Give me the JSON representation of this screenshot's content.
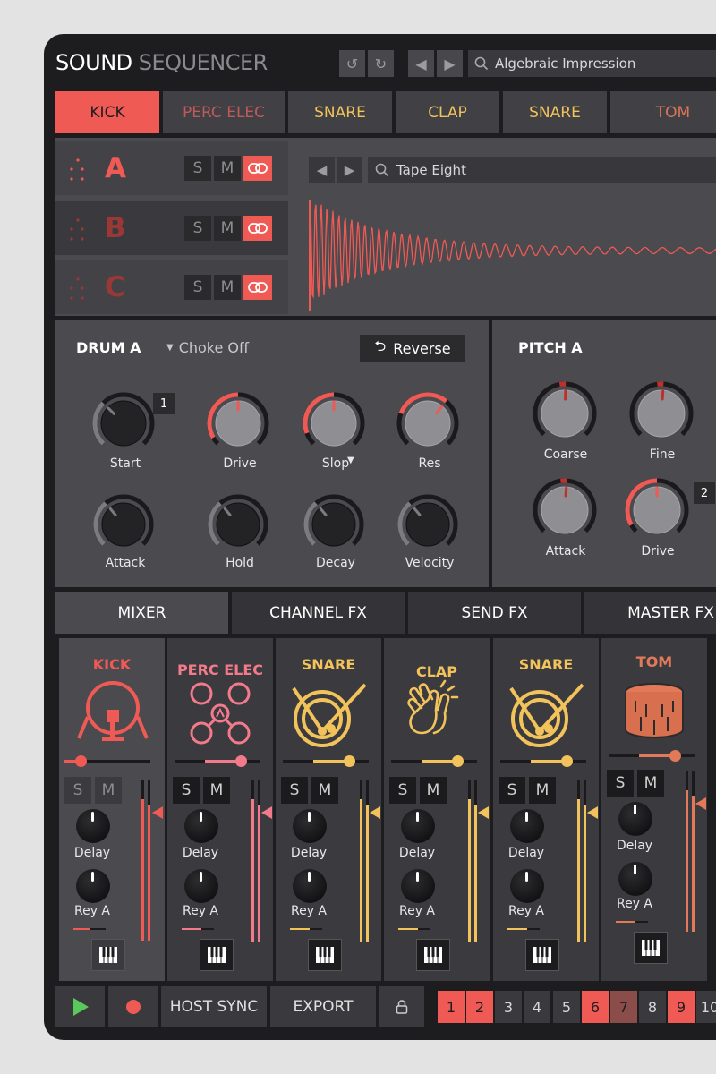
{
  "app": {
    "title_part1": "SOUND",
    "title_part2": "SEQUENCER"
  },
  "toolbar": {
    "search_value": "Algebraic Impression"
  },
  "tabs": [
    {
      "label": "KICK",
      "color": "#f05a55",
      "active": true
    },
    {
      "label": "PERC ELEC",
      "color": "#c05a5a"
    },
    {
      "label": "SNARE",
      "color": "#f2c35a"
    },
    {
      "label": "CLAP",
      "color": "#f2c35a"
    },
    {
      "label": "SNARE",
      "color": "#f2c35a"
    },
    {
      "label": "TOM",
      "color": "#d9765a"
    }
  ],
  "layers": [
    {
      "letter": "A",
      "color": "#f05a55",
      "s": "S",
      "m": "M"
    },
    {
      "letter": "B",
      "color": "#9a3835",
      "s": "S",
      "m": "M"
    },
    {
      "letter": "C",
      "color": "#9a3835",
      "s": "S",
      "m": "M"
    }
  ],
  "sample": {
    "search_value": "Tape Eight"
  },
  "drum": {
    "title": "DRUM A",
    "choke": "Choke Off",
    "reverse": "Reverse",
    "badge": "1",
    "knobs_row1": [
      "Start",
      "Drive",
      "Slop",
      "Res"
    ],
    "knobs_row2": [
      "Attack",
      "Hold",
      "Decay",
      "Velocity"
    ]
  },
  "pitch": {
    "title": "PITCH A",
    "badge": "2",
    "knobs": [
      "Coarse",
      "Fine",
      "Attack",
      "Drive"
    ]
  },
  "lower_tabs": [
    "MIXER",
    "CHANNEL FX",
    "SEND FX",
    "MASTER FX"
  ],
  "strips": [
    {
      "name": "KICK",
      "color": "#f05a55",
      "delay": "Delay",
      "rey": "Rey A",
      "s": "S",
      "m": "M"
    },
    {
      "name": "PERC ELEC",
      "color": "#f27a8a",
      "delay": "Delay",
      "rey": "Rey A",
      "s": "S",
      "m": "M"
    },
    {
      "name": "SNARE",
      "color": "#f2c35a",
      "delay": "Delay",
      "rey": "Rey A",
      "s": "S",
      "m": "M"
    },
    {
      "name": "CLAP",
      "color": "#f2c35a",
      "delay": "Delay",
      "rey": "Rey A",
      "s": "S",
      "m": "M"
    },
    {
      "name": "SNARE",
      "color": "#f2c35a",
      "delay": "Delay",
      "rey": "Rey A",
      "s": "S",
      "m": "M"
    },
    {
      "name": "TOM",
      "color": "#e27a5a",
      "delay": "Delay",
      "rey": "Rey A",
      "s": "S",
      "m": "M"
    }
  ],
  "footer": {
    "host_sync": "HOST SYNC",
    "export": "EXPORT",
    "patterns": [
      {
        "n": "1",
        "active": true
      },
      {
        "n": "2",
        "active": true
      },
      {
        "n": "3",
        "active": false
      },
      {
        "n": "4",
        "active": false
      },
      {
        "n": "5",
        "active": false
      },
      {
        "n": "6",
        "active": true
      },
      {
        "n": "7",
        "active": "dim"
      },
      {
        "n": "8",
        "active": false
      },
      {
        "n": "9",
        "active": true
      },
      {
        "n": "10",
        "active": false
      }
    ]
  },
  "colors": {
    "accent": "#f05a55",
    "panel": "#4a4a4f",
    "dark": "#1d1d20"
  }
}
